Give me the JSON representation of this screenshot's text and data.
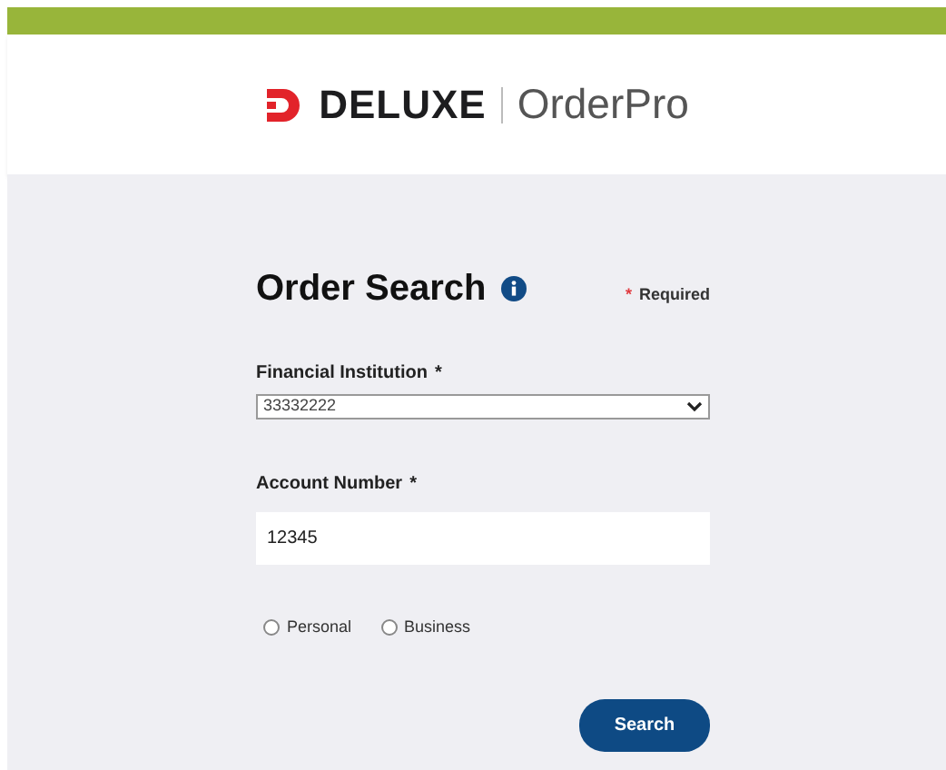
{
  "header": {
    "logo_brand": "DELUXE",
    "logo_product": "OrderPro"
  },
  "form": {
    "title": "Order Search",
    "required_note": {
      "mark": "*",
      "text": "Required"
    },
    "fields": [
      {
        "kind": "select",
        "label": "Financial Institution",
        "required_mark": "*",
        "value": "33332222"
      },
      {
        "kind": "text",
        "label": "Account Number",
        "required_mark": "*",
        "value": "12345"
      }
    ],
    "radios": [
      {
        "label": "Personal",
        "selected": false
      },
      {
        "label": "Business",
        "selected": false
      }
    ],
    "button": "Search"
  }
}
